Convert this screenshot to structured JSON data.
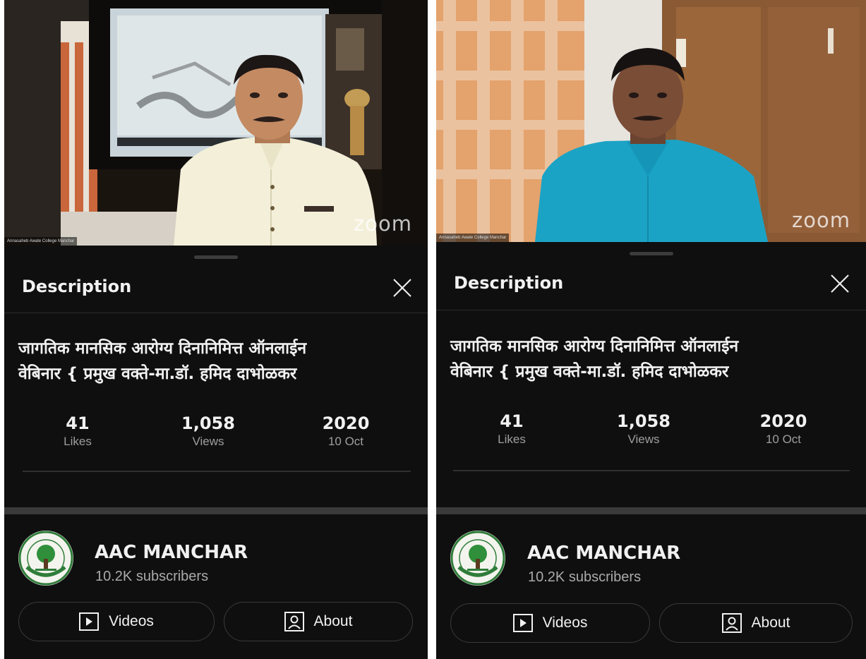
{
  "panels": [
    {
      "video": {
        "watermark": "zoom",
        "caption": "Annasaheb Awate College Manchar"
      },
      "sheet": {
        "header": "Description",
        "title_line1": "जागतिक मानसिक आरोग्य  दिनानिमित्त ऑनलाईन",
        "title_line2": "वेबिनार { प्रमुख वक्ते-मा.डॉ. हमिद दाभोळकर",
        "stats": [
          {
            "value": "41",
            "label": "Likes"
          },
          {
            "value": "1,058",
            "label": "Views"
          },
          {
            "value": "2020",
            "label": "10 Oct"
          }
        ],
        "channel": {
          "name": "AAC MANCHAR",
          "subscribers": "10.2K subscribers"
        },
        "buttons": {
          "videos": "Videos",
          "about": "About"
        }
      }
    },
    {
      "video": {
        "watermark": "zoom",
        "caption": "Annasaheb Awate College Manchar"
      },
      "sheet": {
        "header": "Description",
        "title_line1": "जागतिक मानसिक आरोग्य  दिनानिमित्त ऑनलाईन",
        "title_line2": "वेबिनार { प्रमुख वक्ते-मा.डॉ. हमिद दाभोळकर",
        "stats": [
          {
            "value": "41",
            "label": "Likes"
          },
          {
            "value": "1,058",
            "label": "Views"
          },
          {
            "value": "2020",
            "label": "10 Oct"
          }
        ],
        "channel": {
          "name": "AAC MANCHAR",
          "subscribers": "10.2K subscribers"
        },
        "buttons": {
          "videos": "Videos",
          "about": "About"
        }
      }
    }
  ],
  "colors": {
    "sheet_bg": "#0f0f0f",
    "text_primary": "#f1f1f1",
    "text_secondary": "#aaaaaa",
    "shirt_left": "#f3efd9",
    "shirt_right": "#1ba3c6"
  },
  "icons": [
    "close-icon",
    "play-icon",
    "person-icon",
    "tree-logo-icon"
  ]
}
